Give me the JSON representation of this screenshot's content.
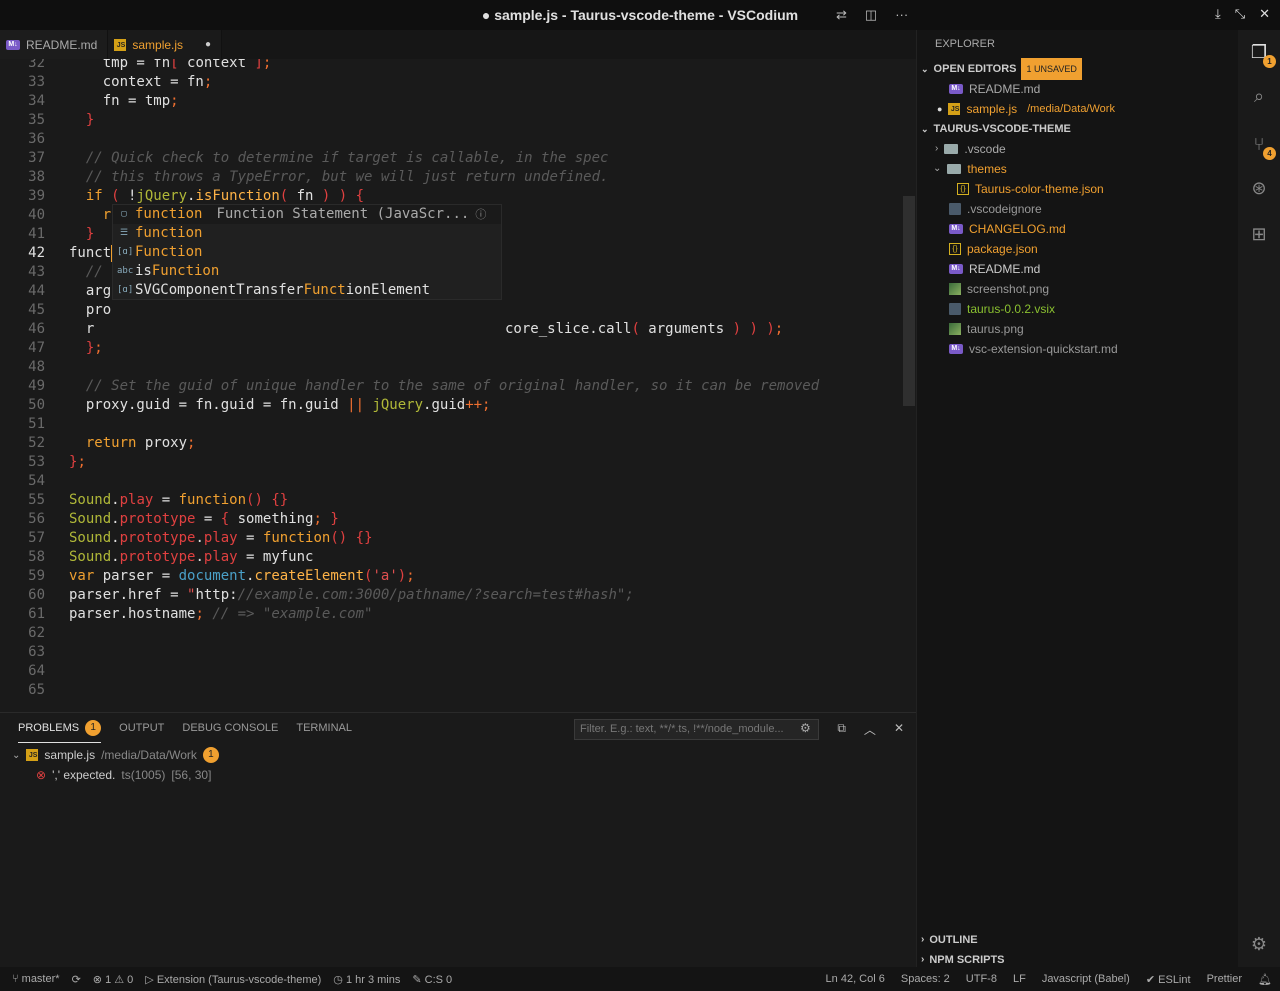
{
  "window": {
    "title": "● sample.js - Taurus-vscode-theme - VSCodium"
  },
  "tabs": [
    {
      "label": "README.md"
    },
    {
      "label": "sample.js",
      "modified": "●"
    }
  ],
  "editor": {
    "lines": [
      {
        "n": "32",
        "html": "  tmp = fn[ context ];"
      },
      {
        "n": "33",
        "t": "  context = fn;"
      },
      {
        "n": "34",
        "t": "  fn = tmp;"
      },
      {
        "n": "35",
        "t": "}"
      },
      {
        "n": "36",
        "t": ""
      },
      {
        "n": "37",
        "t": "// Quick check to determine if target is callable, in the spec"
      },
      {
        "n": "38",
        "t": "// this throws a TypeError, but we will just return undefined."
      },
      {
        "n": "39",
        "t": "if ( !jQuery.isFunction( fn ) ) {"
      },
      {
        "n": "40",
        "t": "  return undefined;"
      },
      {
        "n": "41",
        "t": "}"
      },
      {
        "n": "42",
        "t": "funct"
      },
      {
        "n": "43",
        "t": "// "
      },
      {
        "n": "44",
        "t": "arg"
      },
      {
        "n": "45",
        "t": "pro"
      },
      {
        "n": "46",
        "t": "r"
      },
      {
        "n": "47",
        "t": "};"
      },
      {
        "n": "48",
        "t": ""
      },
      {
        "n": "49",
        "t": "// Set the guid of unique handler to the same of original handler, so it can be removed"
      },
      {
        "n": "50",
        "t": "proxy.guid = fn.guid = fn.guid || jQuery.guid++;"
      },
      {
        "n": "51",
        "t": ""
      },
      {
        "n": "52",
        "t": "return proxy;"
      },
      {
        "n": "53",
        "t": "};"
      },
      {
        "n": "54",
        "t": ""
      },
      {
        "n": "55",
        "t": "Sound.play = function() {}"
      },
      {
        "n": "56",
        "t": "Sound.prototype = { something; }"
      },
      {
        "n": "57",
        "t": "Sound.prototype.play = function() {}"
      },
      {
        "n": "58",
        "t": "Sound.prototype.play = myfunc"
      },
      {
        "n": "59",
        "t": "var parser = document.createElement('a');"
      },
      {
        "n": "60",
        "t": "parser.href = \"http://example.com:3000/pathname/?search=test#hash\";"
      },
      {
        "n": "61",
        "t": "parser.hostname; // => \"example.com\""
      },
      {
        "n": "62",
        "t": ""
      },
      {
        "n": "63",
        "t": ""
      },
      {
        "n": "64",
        "t": ""
      },
      {
        "n": "65",
        "t": ""
      }
    ],
    "line46_tail": "core_slice.call( arguments ) ) );",
    "suggest": [
      {
        "kind": "snippet",
        "pre": "",
        "hl": "function",
        "post": "",
        "detail": "Function Statement (JavaScr..."
      },
      {
        "kind": "keyword",
        "pre": "",
        "hl": "function",
        "post": "",
        "detail": ""
      },
      {
        "kind": "variable",
        "pre": "",
        "hl": "Function",
        "post": "",
        "detail": ""
      },
      {
        "kind": "text",
        "pre": "is",
        "hl": "Function",
        "post": "",
        "detail": ""
      },
      {
        "kind": "variable",
        "pre": "SVGComponentTransfer",
        "hl": "Funct",
        "post": "ionElement",
        "detail": ""
      }
    ]
  },
  "panel": {
    "tabs": [
      "PROBLEMS",
      "OUTPUT",
      "DEBUG CONSOLE",
      "TERMINAL"
    ],
    "problem_count": "1",
    "filter_placeholder": "Filter. E.g.: text, **/*.ts, !**/node_module...",
    "file": "sample.js",
    "path": "/media/Data/Work",
    "file_count": "1",
    "error": "',' expected.",
    "error_code": "ts(1005)",
    "error_pos": "[56, 30]"
  },
  "sidebar": {
    "title": "EXPLORER",
    "open_editors": "OPEN EDITORS",
    "unsaved": "1 UNSAVED",
    "open": [
      {
        "name": "README.md",
        "path": ""
      },
      {
        "name": "sample.js",
        "path": "/media/Data/Work"
      }
    ],
    "project": "TAURUS-VSCODE-THEME",
    "tree": [
      ".vscode",
      "themes",
      "Taurus-color-theme.json",
      ".vscodeignore",
      "CHANGELOG.md",
      "package.json",
      "README.md",
      "screenshot.png",
      "taurus-0.0.2.vsix",
      "taurus.png",
      "vsc-extension-quickstart.md"
    ],
    "outline": "OUTLINE",
    "npm": "NPM SCRIPTS"
  },
  "activity": {
    "explorer_badge": "1",
    "scm_badge": "4"
  },
  "status": {
    "branch": "master*",
    "errors": "1",
    "warnings": "0",
    "extension": "Extension (Taurus-vscode-theme)",
    "time": "1 hr 3 mins",
    "cs": "C:S 0",
    "pos": "Ln 42, Col 6",
    "spaces": "Spaces: 2",
    "enc": "UTF-8",
    "eol": "LF",
    "lang": "Javascript (Babel)",
    "eslint": "ESLint",
    "prettier": "Prettier"
  },
  "colors": {
    "accent": "#f0a030",
    "error": "#e04040",
    "bg": "#1a1a1a"
  }
}
